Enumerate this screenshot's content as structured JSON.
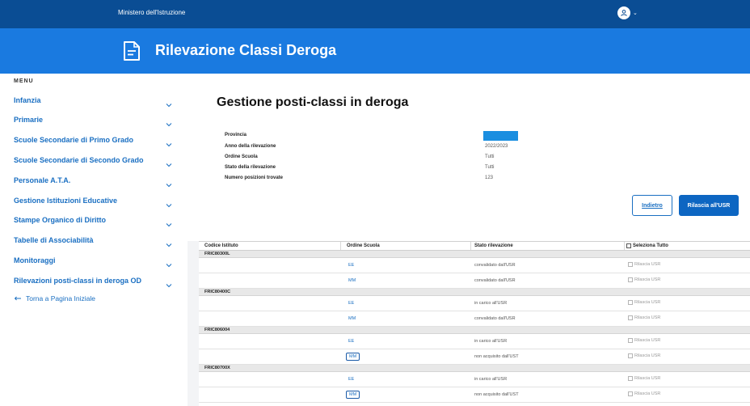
{
  "topbar": {
    "ministry": "Ministero dell'Istruzione"
  },
  "header": {
    "title": "Rilevazione Classi Deroga"
  },
  "sidebar": {
    "menu_label": "MENU",
    "items": [
      {
        "label": "Infanzia"
      },
      {
        "label": "Primarie"
      },
      {
        "label": "Scuole Secondarie di Primo Grado"
      },
      {
        "label": "Scuole Secondarie di Secondo Grado"
      },
      {
        "label": "Personale A.T.A."
      },
      {
        "label": "Gestione Istituzioni Educative"
      },
      {
        "label": "Stampe Organico di Diritto"
      },
      {
        "label": "Tabelle di Associabilità"
      },
      {
        "label": "Monitoraggi"
      },
      {
        "label": "Rilevazioni posti-classi in deroga OD"
      }
    ],
    "home_link": "Torna a Pagina Iniziale"
  },
  "main": {
    "title": "Gestione posti-classi in deroga",
    "info": [
      {
        "label": "Provincia",
        "value": ""
      },
      {
        "label": "Anno della rilevazione",
        "value": "2022/2023"
      },
      {
        "label": "Ordine Scuola",
        "value": "Tutti"
      },
      {
        "label": "Stato della rilevazione",
        "value": "Tutti"
      },
      {
        "label": "Numero posizioni trovate",
        "value": "123"
      }
    ],
    "buttons": {
      "back": "Indietro",
      "release": "Rilascia all'USR"
    }
  },
  "table": {
    "headers": {
      "codice": "Codice Istituto",
      "ordine": "Ordine Scuola",
      "stato": "Stato rilevazione",
      "seleziona": "Seleziona Tutto"
    },
    "groups": [
      {
        "code": "FRIC80300L",
        "rows": [
          {
            "ordine": "EE",
            "stato": "convalidato dall'USR",
            "check": "Rilascia USR"
          },
          {
            "ordine": "MM",
            "stato": "convalidato dall'USR",
            "check": "Rilascia USR"
          }
        ]
      },
      {
        "code": "FRIC80400C",
        "rows": [
          {
            "ordine": "EE",
            "stato": "in carico all'USR",
            "check": "Rilascia USR"
          },
          {
            "ordine": "MM",
            "stato": "convalidato dall'USR",
            "check": "Rilascia USR"
          }
        ]
      },
      {
        "code": "FRIC806004",
        "rows": [
          {
            "ordine": "EE",
            "stato": "in carico all'USR",
            "check": "Rilascia USR"
          },
          {
            "ordine": "MM",
            "stato": "non acquisito dall'UST",
            "check": "Rilascia USR"
          }
        ]
      },
      {
        "code": "FRIC80700X",
        "rows": [
          {
            "ordine": "EE",
            "stato": "in carico all'USR",
            "check": "Rilascia USR"
          },
          {
            "ordine": "MM",
            "stato": "non acquisito dall'UST",
            "check": "Rilascia USR"
          }
        ]
      }
    ]
  }
}
